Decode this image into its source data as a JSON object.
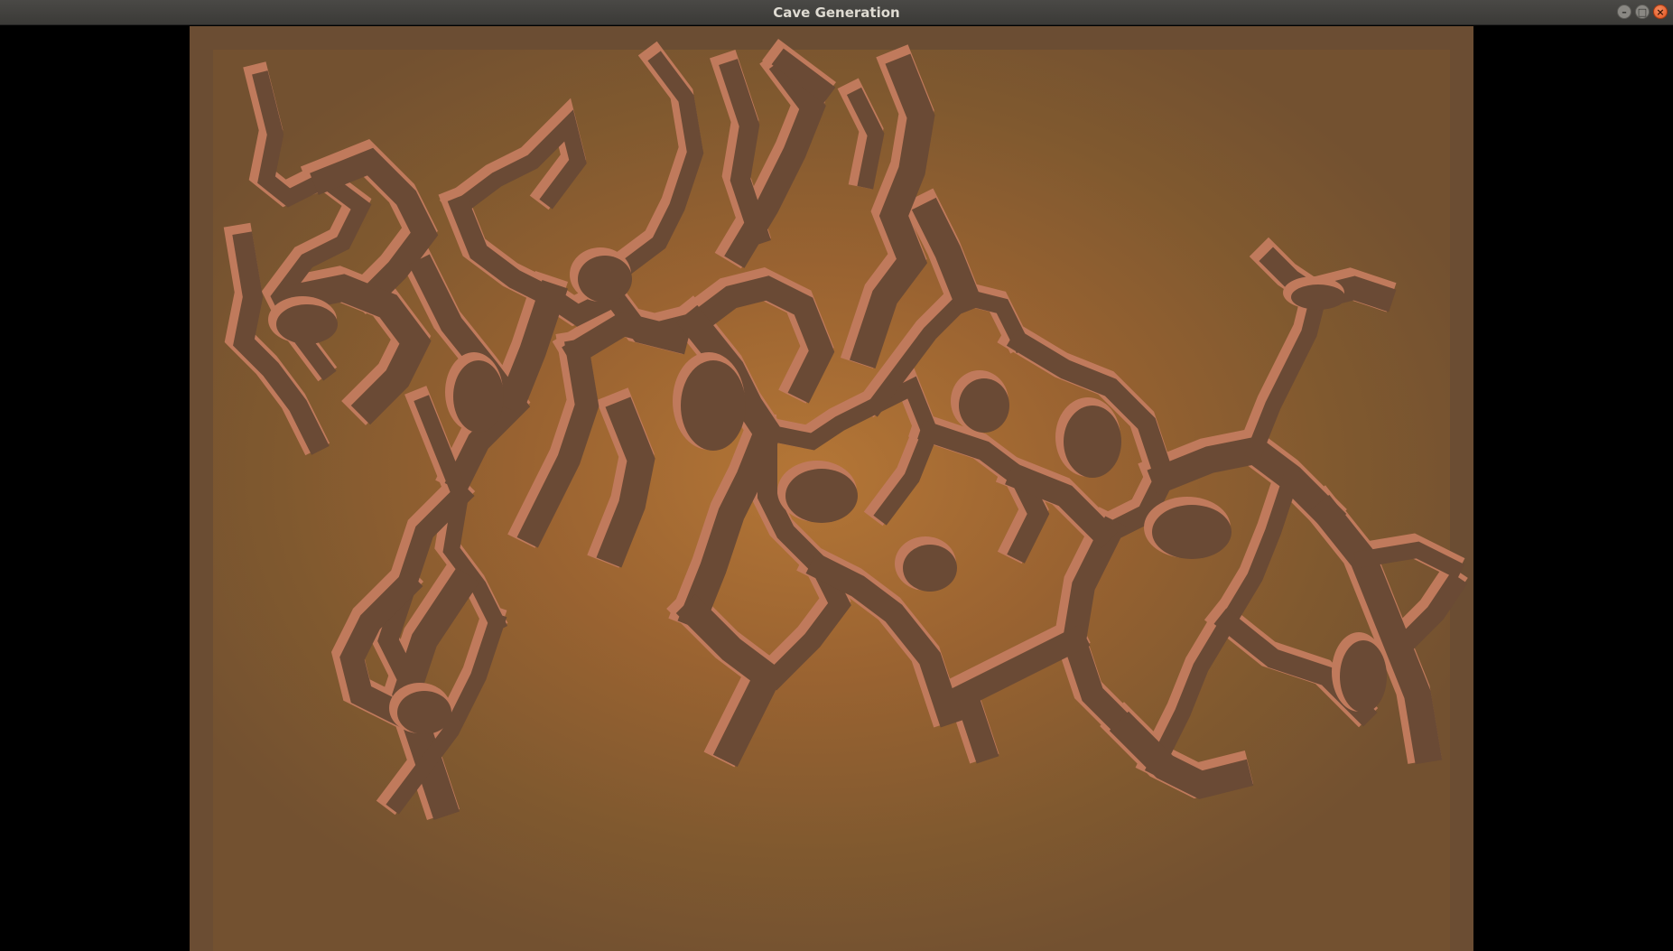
{
  "window": {
    "title": "Cave Generation",
    "controls": {
      "minimize_icon": "minimize-icon",
      "maximize_icon": "maximize-icon",
      "close_icon": "close-icon"
    }
  },
  "scene": {
    "description_colors": {
      "background": "#000000",
      "floor_center": "#b47636",
      "floor_edge": "#735130",
      "wall_dark": "#6a4a35",
      "wall_light": "#c07a5c"
    }
  }
}
